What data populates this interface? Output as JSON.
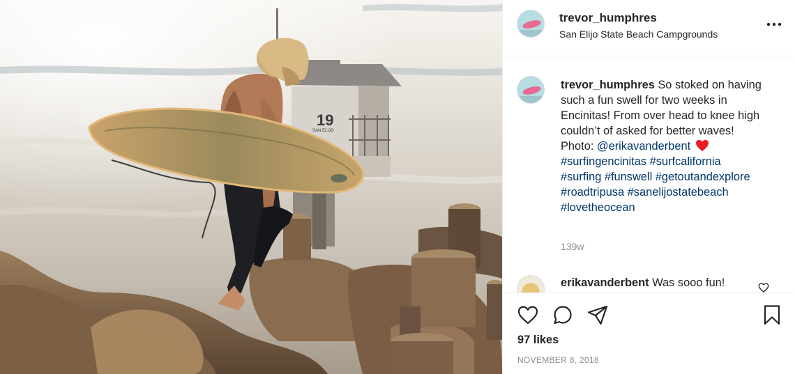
{
  "post": {
    "username": "trevor_humphres",
    "location": "San Elijo State Beach Campgrounds",
    "more_icon": "more-horizontal-icon"
  },
  "photo": {
    "tower_number": "19",
    "tower_sign": "SAN ELIJO"
  },
  "caption": {
    "username": "trevor_humphres",
    "text": " So stoked on having such a fun swell for two weeks in Encinitas! From over head to knee high couldn’t of asked for better waves!",
    "photo_prefix": "Photo: ",
    "photo_credit": "@erikavanderbent",
    "heart_emoji": "red-heart-icon",
    "hashtags": [
      "#surfingencinitas",
      "#surfcalifornia",
      "#surfing",
      "#funswell",
      "#getoutandexplore",
      "#roadtripusa",
      "#sanelijostatebeach",
      "#lovetheocean"
    ],
    "time": "139w"
  },
  "comment": {
    "username": "erikavanderbent",
    "text": " Was sooo fun!"
  },
  "actions": {
    "like_icon": "heart-outline-icon",
    "comment_icon": "comment-bubble-icon",
    "share_icon": "paper-plane-icon",
    "save_icon": "bookmark-icon",
    "likes": "97 likes",
    "date": "NOVEMBER 8, 2018"
  },
  "colors": {
    "link": "#00376b",
    "text": "#262626",
    "muted": "#8e8e8e",
    "heart": "#ed1c24"
  }
}
